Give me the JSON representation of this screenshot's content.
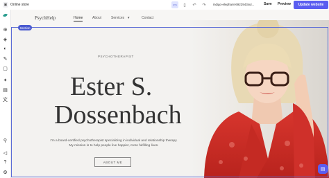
{
  "topbar": {
    "store_label": "Online store",
    "url": "indigo-elephant-6922943sul...",
    "save": "Save",
    "preview": "Preview",
    "update": "Update website"
  },
  "site": {
    "brand": "PsychHelp",
    "nav": [
      "Home",
      "About",
      "Services",
      "Contact"
    ],
    "services_caret": "▾",
    "section_badge": "Section",
    "eyebrow": "PSYCHOTHERAPIST",
    "name_line1": "Ester S.",
    "name_line2": "Dossenbach",
    "description": "I'm a board-certified psychotherapist specializing in individual and relationship therapy. My mission is to help people live happier, more fulfilling lives.",
    "button": "ABOUT ME"
  },
  "colors": {
    "accent": "#5a5df0",
    "section": "#4a5ad0"
  }
}
